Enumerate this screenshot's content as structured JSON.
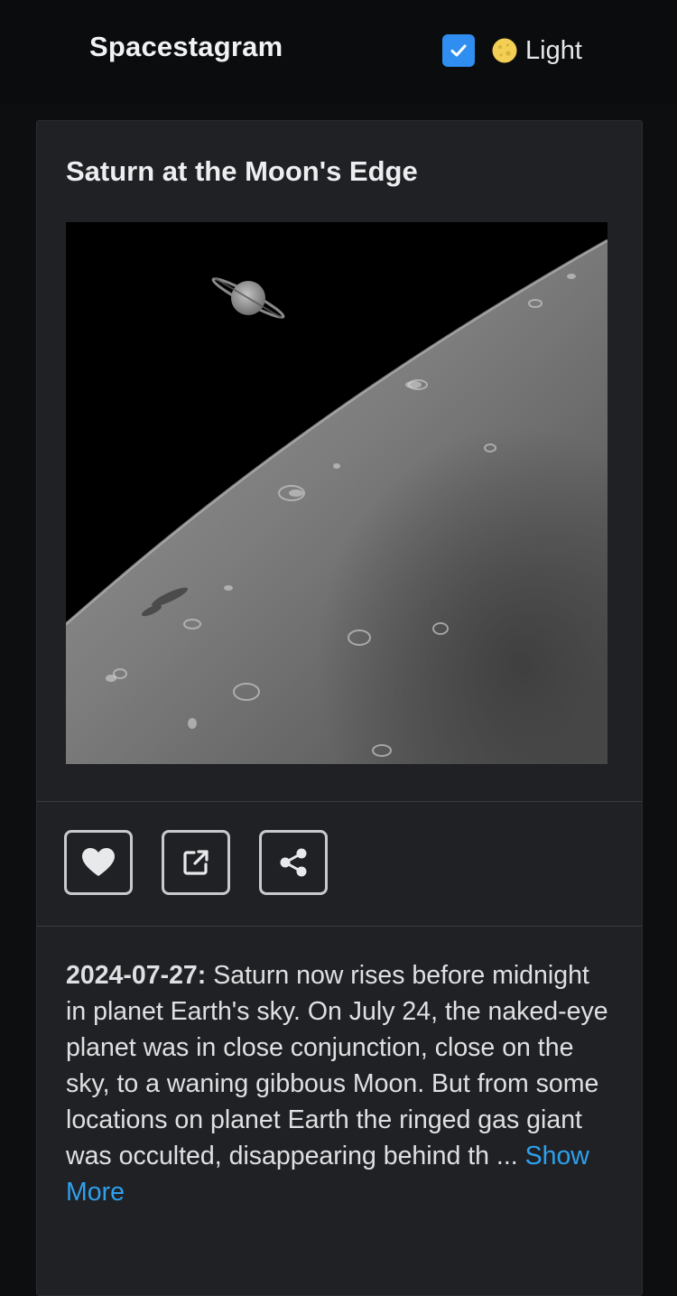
{
  "header": {
    "brand": "Spacestagram",
    "theme_toggle": {
      "checked": true,
      "icon": "moon-icon",
      "label": "Light"
    }
  },
  "post": {
    "title": "Saturn at the Moon's Edge",
    "image_alt": "Saturn at the Moon's Edge",
    "actions": [
      {
        "name": "like",
        "icon": "heart-icon"
      },
      {
        "name": "open",
        "icon": "external-link-icon"
      },
      {
        "name": "share",
        "icon": "share-icon"
      }
    ],
    "date": "2024-07-27:",
    "excerpt": "Saturn now rises before midnight in planet Earth's sky. On July 24, the naked-eye planet was in close conjunction, close on the sky, to a waning gibbous Moon. But from some locations on planet Earth the ringed gas giant was occulted, disappearing behind th ...",
    "show_more": "Show More"
  },
  "colors": {
    "background": "#0d0e10",
    "card": "#202124",
    "accent": "#2f8ef0",
    "link": "#2ea0ee"
  }
}
